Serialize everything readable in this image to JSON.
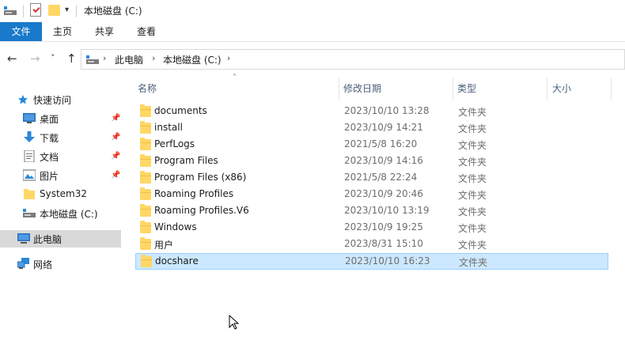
{
  "window": {
    "title": "本地磁盘 (C:)"
  },
  "titlebar": {
    "icons": [
      "drive-icon",
      "properties-icon",
      "new-folder-icon",
      "customize-dropdown-icon"
    ],
    "dropdown_glyph": "▾"
  },
  "ribbon": {
    "tabs": [
      {
        "label": "文件",
        "active": true
      },
      {
        "label": "主页"
      },
      {
        "label": "共享"
      },
      {
        "label": "查看"
      }
    ]
  },
  "colors": {
    "file_tab_bg": "#1979ca",
    "selected_row_bg": "#cce8ff",
    "selected_row_border": "#99d1ff",
    "nav_selected_bg": "#d9d9d9",
    "folder": "#ffd767",
    "header_text": "#4c607a"
  },
  "nav": {
    "back_glyph": "←",
    "forward_glyph": "→",
    "recent_glyph": "˅",
    "up_glyph": "↑"
  },
  "address": {
    "icon": "drive-icon",
    "separator_glyph": "›",
    "crumbs": [
      "此电脑",
      "本地磁盘 (C:)"
    ]
  },
  "navpane": {
    "quick_access": "快速访问",
    "items": [
      {
        "label": "桌面",
        "icon": "desktop-icon",
        "pinned": true
      },
      {
        "label": "下载",
        "icon": "download-icon",
        "pinned": true
      },
      {
        "label": "文档",
        "icon": "documents-icon",
        "pinned": true
      },
      {
        "label": "图片",
        "icon": "pictures-icon",
        "pinned": true
      },
      {
        "label": "System32",
        "icon": "folder-icon",
        "pinned": false
      },
      {
        "label": "本地磁盘 (C:)",
        "icon": "drive-icon",
        "pinned": false
      }
    ],
    "this_pc": "此电脑",
    "network": "网络",
    "pin_glyph": "📌"
  },
  "columns": {
    "name": "名称",
    "date": "修改日期",
    "type": "类型",
    "size": "大小",
    "sort_glyph": "˄"
  },
  "files": [
    {
      "name": "documents",
      "date": "2023/10/10 13:28",
      "type": "文件夹"
    },
    {
      "name": "install",
      "date": "2023/10/9 14:21",
      "type": "文件夹"
    },
    {
      "name": "PerfLogs",
      "date": "2021/5/8 16:20",
      "type": "文件夹"
    },
    {
      "name": "Program Files",
      "date": "2023/10/9 14:16",
      "type": "文件夹"
    },
    {
      "name": "Program Files (x86)",
      "date": "2021/5/8 22:24",
      "type": "文件夹"
    },
    {
      "name": "Roaming Profiles",
      "date": "2023/10/9 20:46",
      "type": "文件夹"
    },
    {
      "name": "Roaming Profiles.V6",
      "date": "2023/10/10 13:19",
      "type": "文件夹"
    },
    {
      "name": "Windows",
      "date": "2023/10/9 19:25",
      "type": "文件夹"
    },
    {
      "name": "用户",
      "date": "2023/8/31 15:10",
      "type": "文件夹"
    },
    {
      "name": "docshare",
      "date": "2023/10/10 16:23",
      "type": "文件夹",
      "selected": true
    }
  ]
}
